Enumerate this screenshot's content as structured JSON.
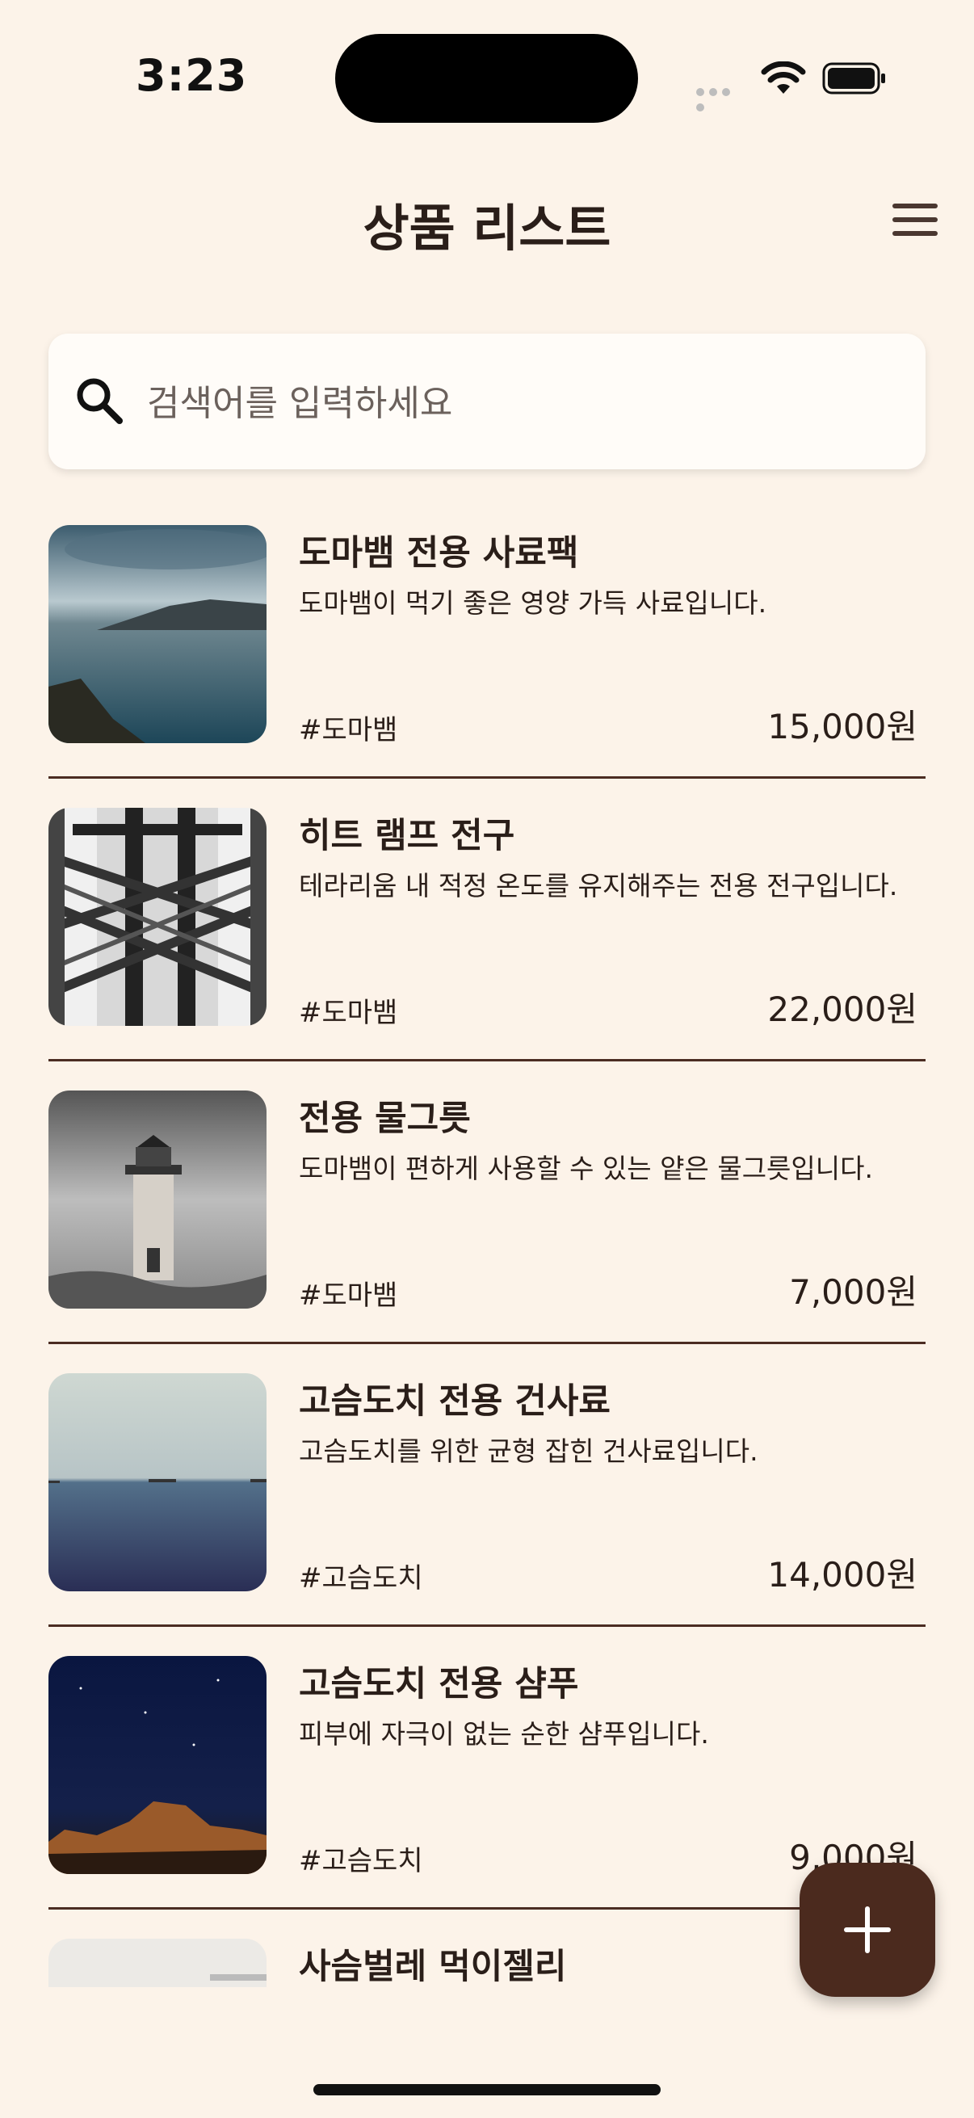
{
  "status_bar": {
    "time": "3:23"
  },
  "header": {
    "title": "상품 리스트",
    "menu_icon": "hamburger-menu-icon"
  },
  "search": {
    "placeholder": "검색어를 입력하세요",
    "value": "",
    "icon": "search-icon"
  },
  "products": [
    {
      "title": "도마뱀 전용 사료팩",
      "description": "도마뱀이 먹기 좋은 영양 가득 사료입니다.",
      "tag": "#도마뱀",
      "price": "15,000원",
      "image": "lake-mountains"
    },
    {
      "title": "히트 램프 전구",
      "description": "테라리움 내 적정 온도를 유지해주는 전용 전구입니다.",
      "tag": "#도마뱀",
      "price": "22,000원",
      "image": "steel-bridge-bw"
    },
    {
      "title": "전용 물그릇",
      "description": "도마뱀이 편하게 사용할 수 있는 얕은 물그릇입니다.",
      "tag": "#도마뱀",
      "price": "7,000원",
      "image": "lighthouse-bw"
    },
    {
      "title": "고슴도치 전용 건사료",
      "description": "고슴도치를 위한 균형 잡힌 건사료입니다.",
      "tag": "#고슴도치",
      "price": "14,000원",
      "image": "sea-ships"
    },
    {
      "title": "고슴도치 전용 샴푸",
      "description": "피부에 자극이 없는 순한 샴푸입니다.",
      "tag": "#고슴도치",
      "price": "9,000원",
      "image": "night-desert"
    },
    {
      "title": "사슴벌레 먹이젤리",
      "description": "",
      "tag": "",
      "price": "",
      "image": "snow-landscape"
    }
  ],
  "fab": {
    "icon": "plus-icon"
  },
  "colors": {
    "background": "#FCF3E9",
    "accent": "#4B2A1E",
    "divider": "#4B2C22",
    "text": "#2A1E19"
  }
}
